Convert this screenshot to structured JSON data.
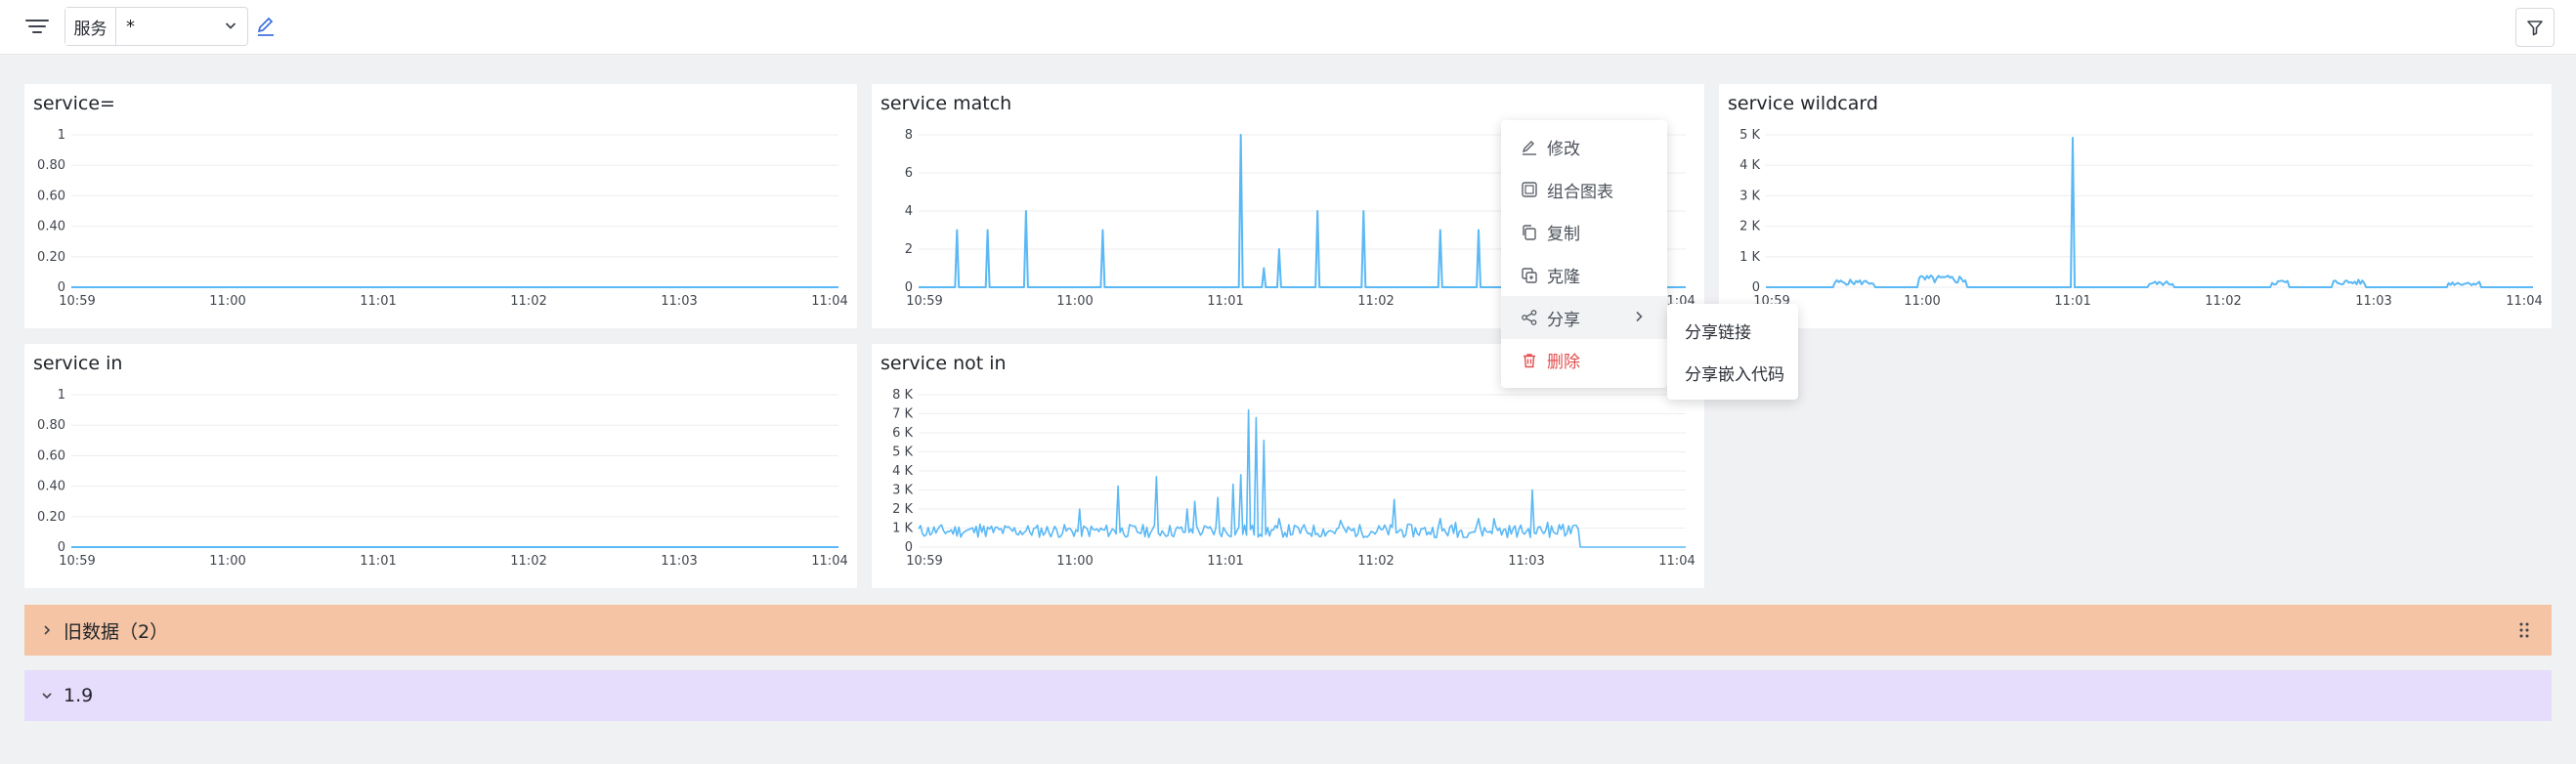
{
  "toolbar": {
    "variable_label": "服务",
    "variable_value": "*"
  },
  "context_menu": {
    "items": [
      {
        "label": "修改",
        "icon": "edit-icon"
      },
      {
        "label": "组合图表",
        "icon": "combine-chart-icon"
      },
      {
        "label": "复制",
        "icon": "copy-icon"
      },
      {
        "label": "克隆",
        "icon": "clone-icon"
      },
      {
        "label": "分享",
        "icon": "share-icon"
      },
      {
        "label": "删除",
        "icon": "trash-icon",
        "color": "#e34d4d"
      }
    ],
    "share_submenu": [
      "分享链接",
      "分享嵌入代码"
    ]
  },
  "rows": [
    {
      "label": "旧数据（2）",
      "collapsed": true,
      "color": "#f5c4a4"
    },
    {
      "label": "1.9",
      "collapsed": false,
      "color": "#e6dcfb"
    }
  ],
  "colors": {
    "series": "#5ab8f5",
    "accent": "#3b6fe0"
  },
  "panels": [
    {
      "title": "service=",
      "chart_data": {
        "type": "line",
        "x_ticks": [
          "10:59",
          "11:00",
          "11:01",
          "11:02",
          "11:03",
          "11:04"
        ],
        "y_ticks": [
          "0",
          "0.20",
          "0.40",
          "0.60",
          "0.80",
          "1"
        ],
        "ylim": [
          0,
          1
        ],
        "grid": true,
        "series": [
          {
            "values": [
              0,
              0,
              0,
              0,
              0,
              0
            ]
          }
        ]
      }
    },
    {
      "title": "service match",
      "chart_data": {
        "type": "line",
        "x_ticks": [
          "10:59",
          "11:00",
          "11:01",
          "11:02",
          "11:03",
          "11:04"
        ],
        "y_ticks": [
          "0",
          "2",
          "4",
          "6",
          "8"
        ],
        "ylim": [
          0,
          8
        ],
        "grid": true,
        "baseline": 0,
        "spikes": [
          [
            0.05,
            3
          ],
          [
            0.09,
            3
          ],
          [
            0.14,
            4
          ],
          [
            0.24,
            3
          ],
          [
            0.42,
            8
          ],
          [
            0.45,
            1
          ],
          [
            0.47,
            2
          ],
          [
            0.52,
            4
          ],
          [
            0.58,
            4
          ],
          [
            0.68,
            3
          ],
          [
            0.73,
            3
          ],
          [
            0.77,
            4
          ],
          [
            0.82,
            1
          ]
        ]
      }
    },
    {
      "title": "service wildcard",
      "chart_data": {
        "type": "line",
        "x_ticks": [
          "10:59",
          "11:00",
          "11:01",
          "11:02",
          "11:03",
          "11:04"
        ],
        "y_ticks": [
          "0",
          "1 K",
          "2 K",
          "3 K",
          "4 K",
          "5 K"
        ],
        "ylim": [
          0,
          5000
        ],
        "grid": true,
        "baseline": 0,
        "noise": [
          [
            0.09,
            0.14,
            250
          ],
          [
            0.2,
            0.26,
            400
          ],
          [
            0.5,
            0.53,
            200
          ],
          [
            0.66,
            0.68,
            250
          ],
          [
            0.74,
            0.78,
            250
          ],
          [
            0.89,
            0.93,
            200
          ]
        ],
        "spikes": [
          [
            0.4,
            4900
          ]
        ]
      }
    },
    {
      "title": "service in",
      "chart_data": {
        "type": "line",
        "x_ticks": [
          "10:59",
          "11:00",
          "11:01",
          "11:02",
          "11:03",
          "11:04"
        ],
        "y_ticks": [
          "0",
          "0.20",
          "0.40",
          "0.60",
          "0.80",
          "1"
        ],
        "ylim": [
          0,
          1
        ],
        "grid": true,
        "series": [
          {
            "values": [
              0,
              0,
              0,
              0,
              0,
              0
            ]
          }
        ]
      }
    },
    {
      "title": "service not in",
      "chart_data": {
        "type": "line",
        "x_ticks": [
          "10:59",
          "11:00",
          "11:01",
          "11:02",
          "11:03",
          "11:04"
        ],
        "y_ticks": [
          "0",
          "1 K",
          "2 K",
          "3 K",
          "4 K",
          "5 K",
          "6 K",
          "7 K",
          "8 K"
        ],
        "ylim": [
          0,
          8000
        ],
        "grid": true,
        "noise_end": 0.86,
        "spikes": [
          [
            0.08,
            1200
          ],
          [
            0.21,
            2000
          ],
          [
            0.26,
            3200
          ],
          [
            0.31,
            3700
          ],
          [
            0.35,
            2000
          ],
          [
            0.36,
            2400
          ],
          [
            0.39,
            2600
          ],
          [
            0.41,
            3300
          ],
          [
            0.42,
            3800
          ],
          [
            0.43,
            7200
          ],
          [
            0.44,
            6800
          ],
          [
            0.45,
            5600
          ],
          [
            0.47,
            1500
          ],
          [
            0.55,
            1400
          ],
          [
            0.62,
            2500
          ],
          [
            0.68,
            1500
          ],
          [
            0.7,
            1300
          ],
          [
            0.73,
            1500
          ],
          [
            0.75,
            1500
          ],
          [
            0.8,
            3000
          ],
          [
            0.82,
            1300
          ],
          [
            0.84,
            1200
          ]
        ]
      }
    }
  ]
}
